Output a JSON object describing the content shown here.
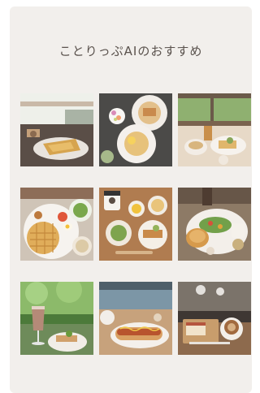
{
  "section": {
    "title": "ことりっぷAIのおすすめ"
  },
  "photos": [
    {
      "name": "cafe-terrace-waffle-photo",
      "alt": ""
    },
    {
      "name": "breakfast-plates-flowers-photo",
      "alt": ""
    },
    {
      "name": "window-cafe-table-photo",
      "alt": ""
    },
    {
      "name": "waffle-plate-salad-photo",
      "alt": ""
    },
    {
      "name": "wooden-tray-lunch-photo",
      "alt": ""
    },
    {
      "name": "bread-salad-drinks-photo",
      "alt": ""
    },
    {
      "name": "chocolate-drink-garden-photo",
      "alt": ""
    },
    {
      "name": "hotdog-sandwich-photo",
      "alt": ""
    },
    {
      "name": "cake-coffee-tray-photo",
      "alt": ""
    }
  ]
}
